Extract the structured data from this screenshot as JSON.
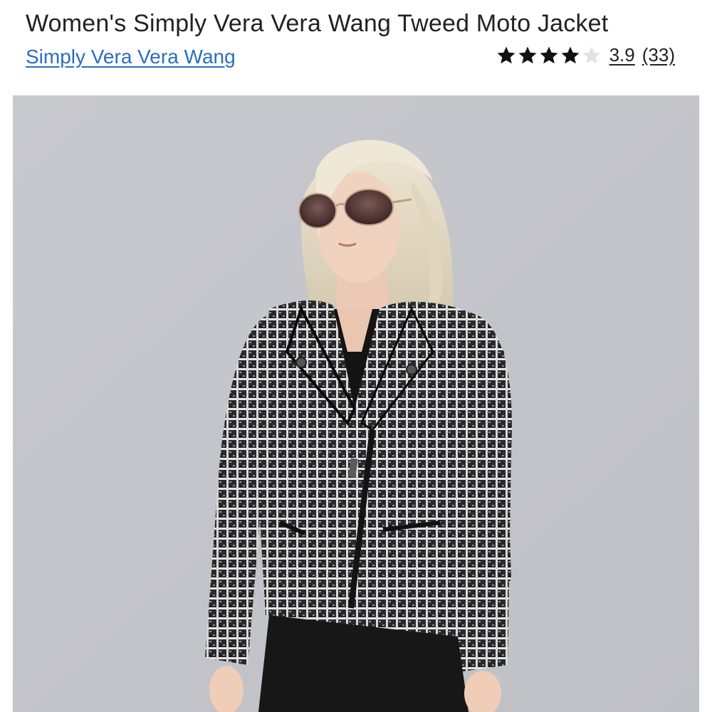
{
  "product": {
    "title": "Women's Simply Vera Vera Wang Tweed Moto Jacket",
    "brand_link": "Simply Vera Vera Wang",
    "rating": {
      "stars_filled": 4,
      "stars_total": 5,
      "value": "3.9",
      "count": "(33)"
    }
  },
  "image": {
    "alt": "Model wearing black and white tweed moto jacket with sunglasses",
    "background_color": "#c5c6cb"
  },
  "colors": {
    "link": "#2a6ebd",
    "text": "#222222",
    "star_filled": "#111111",
    "star_empty": "#e2e2e2"
  }
}
